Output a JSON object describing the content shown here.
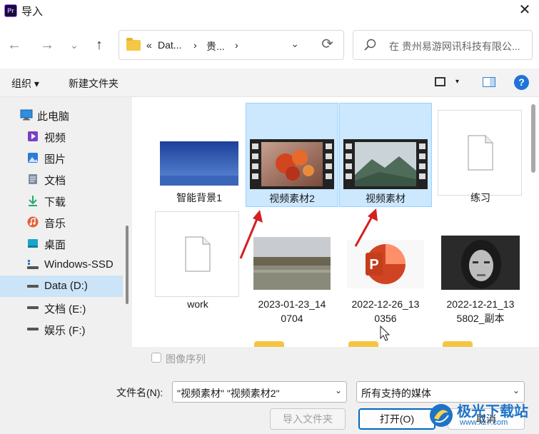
{
  "window": {
    "title": "导入",
    "app_icon": "Pr",
    "close": "✕"
  },
  "nav": {
    "back": "←",
    "forward": "→",
    "recent": "⌄",
    "up": "↑",
    "address": {
      "prefix": "«",
      "segments": [
        "Dat...",
        "贵..."
      ],
      "separator": "›"
    },
    "search_placeholder": "在 贵州易游网讯科技有限公..."
  },
  "toolbar": {
    "organize": "组织 ▾",
    "new_folder": "新建文件夹",
    "help": "?",
    "view_caret": "▾"
  },
  "sidebar": {
    "items": [
      {
        "label": "此电脑",
        "icon": "computer-icon"
      },
      {
        "label": "视频",
        "icon": "video-folder-icon"
      },
      {
        "label": "图片",
        "icon": "pictures-folder-icon"
      },
      {
        "label": "文档",
        "icon": "documents-folder-icon"
      },
      {
        "label": "下载",
        "icon": "download-icon"
      },
      {
        "label": "音乐",
        "icon": "music-icon"
      },
      {
        "label": "桌面",
        "icon": "desktop-icon"
      },
      {
        "label": "Windows-SSD",
        "icon": "drive-icon"
      },
      {
        "label": "Data (D:)",
        "icon": "drive-icon",
        "selected": true
      },
      {
        "label": "文档 (E:)",
        "icon": "drive-icon"
      },
      {
        "label": "娱乐 (F:)",
        "icon": "drive-icon"
      }
    ]
  },
  "files": [
    {
      "label": "智能背景1",
      "kind": "image-blue"
    },
    {
      "label": "视频素材2",
      "kind": "video-maple",
      "selected": true
    },
    {
      "label": "视频素材",
      "kind": "video-mountain",
      "selected": true
    },
    {
      "label": "练习",
      "kind": "document"
    },
    {
      "label": "work",
      "kind": "document"
    },
    {
      "label": "2023-01-23_14",
      "label2": "0704",
      "kind": "image-lake"
    },
    {
      "label": "2022-12-26_13",
      "label2": "0356",
      "kind": "powerpoint"
    },
    {
      "label": "2022-12-21_13",
      "label2": "5802_副本",
      "kind": "portrait"
    }
  ],
  "options": {
    "image_sequence": "图像序列"
  },
  "bottom": {
    "filename_label": "文件名(N):",
    "filename_value": "\"视频素材\" \"视频素材2\"",
    "filetype_value": "所有支持的媒体",
    "import_folder": "导入文件夹",
    "open": "打开(O)",
    "cancel": "取消"
  },
  "watermark": {
    "name": "极光下载站",
    "url": "www.xz7.com"
  },
  "colors": {
    "selection": "#cce8ff",
    "accent": "#0067c0",
    "annotation_arrow": "#d42020"
  }
}
